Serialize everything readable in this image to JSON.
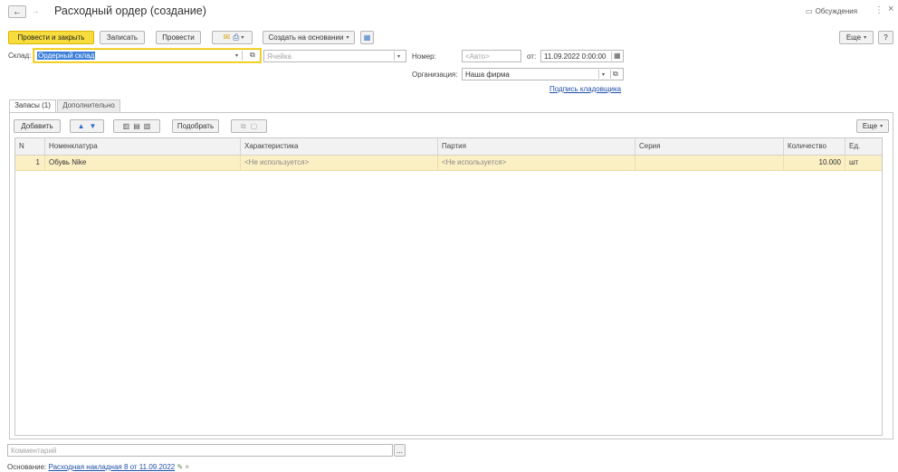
{
  "title": "Расходный ордер (создание)",
  "header_right": {
    "discussions": "Обсуждения",
    "menu": "⋮",
    "close": "×"
  },
  "toolbar": {
    "post_close": "Провести и закрыть",
    "save": "Записать",
    "post": "Провести",
    "create_basis": "Создать на основании",
    "more": "Еще",
    "help": "?"
  },
  "form": {
    "warehouse_label": "Склад:",
    "warehouse_value": "Ордерный склад",
    "cell_placeholder": "Ячейка",
    "number_label": "Номер:",
    "number_placeholder": "<Авто>",
    "from_label": "от:",
    "date_value": "11.09.2022  0:00:00",
    "org_label": "Организация:",
    "org_value": "Наша фирма",
    "signature_link": "Подпись кладовщика"
  },
  "tabs": [
    {
      "label": "Запасы (1)",
      "active": true
    },
    {
      "label": "Дополнительно",
      "active": false
    }
  ],
  "table_toolbar": {
    "add": "Добавить",
    "pick": "Подобрать",
    "more": "Еще"
  },
  "table": {
    "columns": [
      "N",
      "Номенклатура",
      "Характеристика",
      "Партия",
      "Серия",
      "Количество",
      "Ед."
    ],
    "rows": [
      {
        "n": "1",
        "item": "Обувь Nike",
        "characteristic": "<Не используется>",
        "batch": "<Не используется>",
        "series": "",
        "qty": "10.000",
        "unit": "шт"
      }
    ]
  },
  "comment_placeholder": "Комментарий",
  "comment_btn": "...",
  "footer": {
    "basis_label": "Основание:",
    "basis_link": "Расходная накладная 8 от 11.09.2022"
  }
}
